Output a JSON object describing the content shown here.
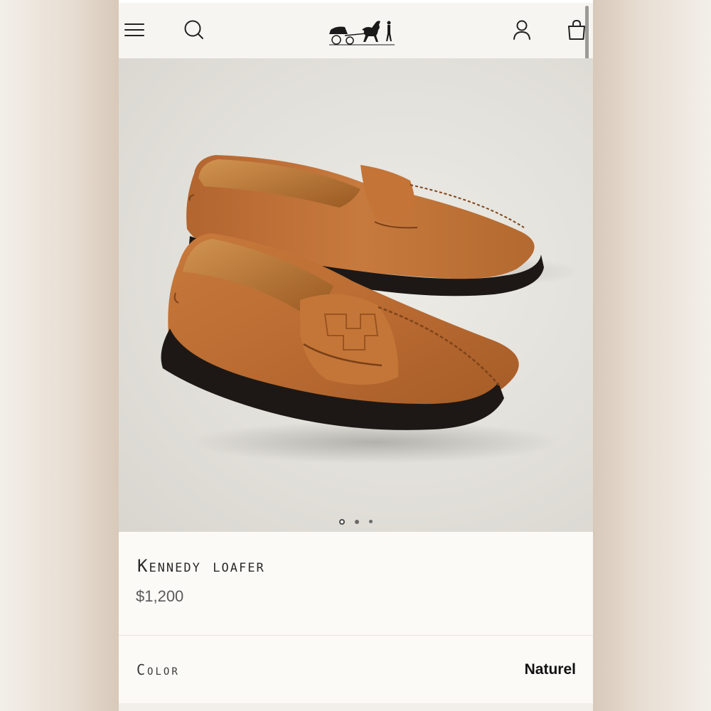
{
  "header": {
    "icons": [
      "menu-icon",
      "search-icon",
      "horse-carriage-logo",
      "account-icon",
      "shopping-bag-icon"
    ]
  },
  "hero": {
    "carousel": {
      "count": 3,
      "active_index": 0
    }
  },
  "product": {
    "title": "Kennedy loafer",
    "price": "$1,200"
  },
  "color": {
    "label": "Color",
    "value": "Naturel"
  },
  "colors": {
    "page_bg": "#f7f5f1",
    "leather": "#b8692f",
    "sole": "#1f1a17"
  }
}
